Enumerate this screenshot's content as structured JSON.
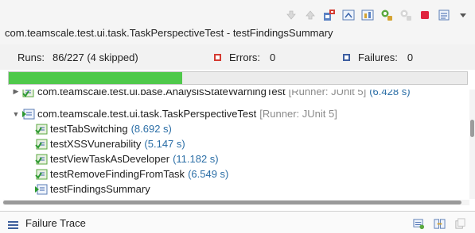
{
  "view": {
    "title": "com.teamscale.test.ui.task.TaskPerspectiveTest - testFindingsSummary"
  },
  "toolbar_icons": [
    "next-failure-icon",
    "previous-failure-icon",
    "show-failures-only-icon",
    "scroll-lock-icon",
    "show-skipped-icon",
    "rerun-icon",
    "rerun-failed-first-icon",
    "stop-icon",
    "history-icon",
    "view-menu-icon"
  ],
  "stats": {
    "runs_label": "Runs:",
    "runs_value": "86/227 (4 skipped)",
    "errors_label": "Errors:",
    "errors_value": "0",
    "failures_label": "Failures:",
    "failures_value": "0",
    "error_color": "#d43b32",
    "failure_color": "#3e5fa1"
  },
  "progress": {
    "fraction": 0.3789,
    "color": "#4fc94b"
  },
  "tree": {
    "partial_row": {
      "name": "com.teamscale.test.ui.base.AnalysisStateWarningTest",
      "runner": "[Runner: JUnit 5]",
      "time": "(6.428 s)"
    },
    "suite": {
      "name": "com.teamscale.test.ui.task.TaskPerspectiveTest",
      "runner": "[Runner: JUnit 5]"
    },
    "tests": [
      {
        "name": "testTabSwitching",
        "time": "(8.692 s)",
        "status": "passed"
      },
      {
        "name": "testXSSVunerability",
        "time": "(5.147 s)",
        "status": "passed"
      },
      {
        "name": "testViewTaskAsDeveloper",
        "time": "(11.182 s)",
        "status": "passed"
      },
      {
        "name": "testRemoveFindingFromTask",
        "time": "(6.549 s)",
        "status": "passed"
      },
      {
        "name": "testFindingsSummary",
        "time": "",
        "status": "running"
      }
    ]
  },
  "failure_trace": {
    "label": "Failure Trace"
  }
}
